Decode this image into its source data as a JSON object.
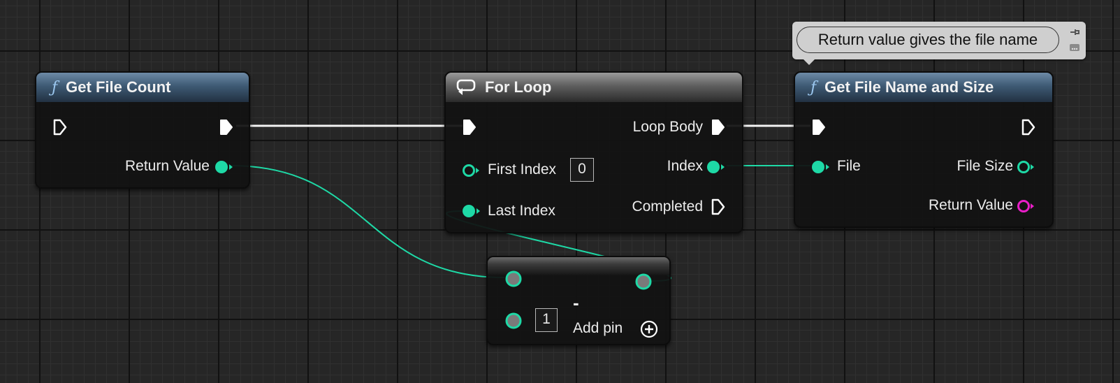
{
  "nodes": {
    "get_file_count": {
      "title": "Get File Count",
      "icon": "function-icon",
      "outputs": {
        "return_value": "Return Value"
      }
    },
    "for_loop": {
      "title": "For Loop",
      "icon": "loop-icon",
      "inputs": {
        "first_index": "First Index",
        "first_index_value": "0",
        "last_index": "Last Index"
      },
      "outputs": {
        "loop_body": "Loop Body",
        "index": "Index",
        "completed": "Completed"
      }
    },
    "get_file_name_and_size": {
      "title": "Get File Name and Size",
      "icon": "function-icon",
      "inputs": {
        "file": "File"
      },
      "outputs": {
        "file_size": "File Size",
        "return_value": "Return Value"
      }
    },
    "subtract": {
      "operator": "-",
      "second_input_value": "1",
      "add_pin": "Add pin"
    }
  },
  "comment": {
    "text": "Return value gives the file name"
  },
  "colors": {
    "integer_pin": "#1ed9a6",
    "string_pin": "#e91ec8",
    "wildcard_pin": "#7a7a7a",
    "exec_pin": "#ffffff",
    "function_header": "#3e5a74",
    "macro_header": "#5e5e5e"
  }
}
